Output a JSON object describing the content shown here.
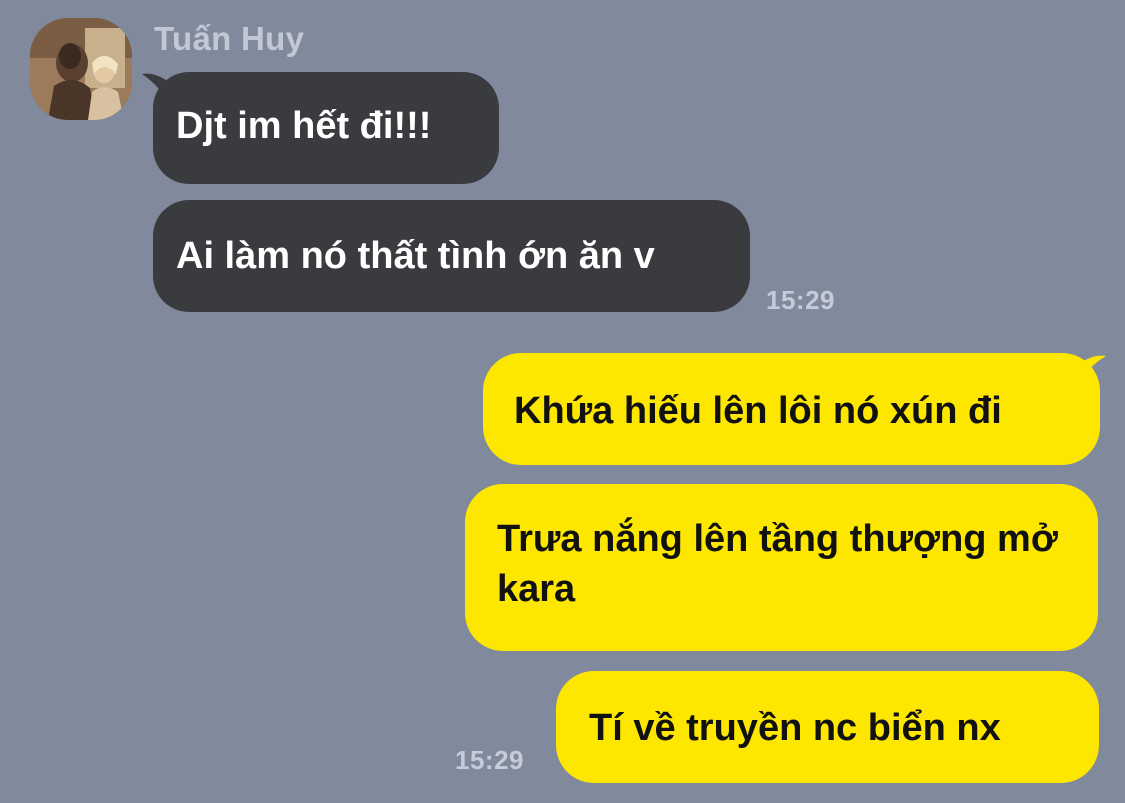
{
  "conversation": {
    "contact": {
      "name": "Tuấn Huy",
      "avatar": "user-avatar-photo"
    },
    "incoming": [
      {
        "text": "Djt im hết đi!!!"
      },
      {
        "text": "Ai làm nó thất tình ớn ăn v"
      }
    ],
    "incoming_time": "15:29",
    "outgoing": [
      {
        "text": "Khứa hiếu lên lôi nó xún đi"
      },
      {
        "text": "Trưa nắng lên tầng thượng mở kara"
      },
      {
        "text": "Tí về truyền nc biển nx"
      }
    ],
    "outgoing_time": "15:29"
  },
  "colors": {
    "background": "#808a9c",
    "incoming_bubble": "#3a3b3f",
    "outgoing_bubble": "#fde600"
  }
}
